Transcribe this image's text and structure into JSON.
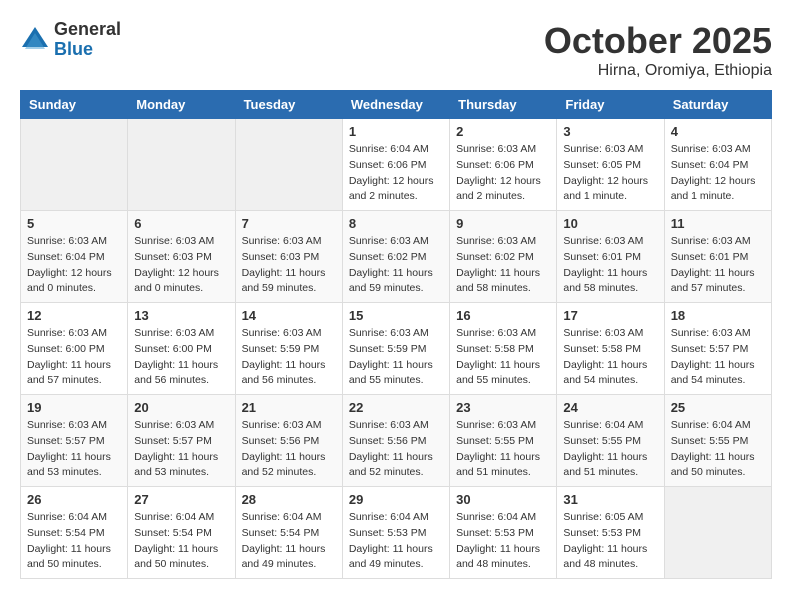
{
  "logo": {
    "general": "General",
    "blue": "Blue"
  },
  "header": {
    "month": "October 2025",
    "location": "Hirna, Oromiya, Ethiopia"
  },
  "weekdays": [
    "Sunday",
    "Monday",
    "Tuesday",
    "Wednesday",
    "Thursday",
    "Friday",
    "Saturday"
  ],
  "weeks": [
    [
      {
        "day": "",
        "info": ""
      },
      {
        "day": "",
        "info": ""
      },
      {
        "day": "",
        "info": ""
      },
      {
        "day": "1",
        "info": "Sunrise: 6:04 AM\nSunset: 6:06 PM\nDaylight: 12 hours\nand 2 minutes."
      },
      {
        "day": "2",
        "info": "Sunrise: 6:03 AM\nSunset: 6:06 PM\nDaylight: 12 hours\nand 2 minutes."
      },
      {
        "day": "3",
        "info": "Sunrise: 6:03 AM\nSunset: 6:05 PM\nDaylight: 12 hours\nand 1 minute."
      },
      {
        "day": "4",
        "info": "Sunrise: 6:03 AM\nSunset: 6:04 PM\nDaylight: 12 hours\nand 1 minute."
      }
    ],
    [
      {
        "day": "5",
        "info": "Sunrise: 6:03 AM\nSunset: 6:04 PM\nDaylight: 12 hours\nand 0 minutes."
      },
      {
        "day": "6",
        "info": "Sunrise: 6:03 AM\nSunset: 6:03 PM\nDaylight: 12 hours\nand 0 minutes."
      },
      {
        "day": "7",
        "info": "Sunrise: 6:03 AM\nSunset: 6:03 PM\nDaylight: 11 hours\nand 59 minutes."
      },
      {
        "day": "8",
        "info": "Sunrise: 6:03 AM\nSunset: 6:02 PM\nDaylight: 11 hours\nand 59 minutes."
      },
      {
        "day": "9",
        "info": "Sunrise: 6:03 AM\nSunset: 6:02 PM\nDaylight: 11 hours\nand 58 minutes."
      },
      {
        "day": "10",
        "info": "Sunrise: 6:03 AM\nSunset: 6:01 PM\nDaylight: 11 hours\nand 58 minutes."
      },
      {
        "day": "11",
        "info": "Sunrise: 6:03 AM\nSunset: 6:01 PM\nDaylight: 11 hours\nand 57 minutes."
      }
    ],
    [
      {
        "day": "12",
        "info": "Sunrise: 6:03 AM\nSunset: 6:00 PM\nDaylight: 11 hours\nand 57 minutes."
      },
      {
        "day": "13",
        "info": "Sunrise: 6:03 AM\nSunset: 6:00 PM\nDaylight: 11 hours\nand 56 minutes."
      },
      {
        "day": "14",
        "info": "Sunrise: 6:03 AM\nSunset: 5:59 PM\nDaylight: 11 hours\nand 56 minutes."
      },
      {
        "day": "15",
        "info": "Sunrise: 6:03 AM\nSunset: 5:59 PM\nDaylight: 11 hours\nand 55 minutes."
      },
      {
        "day": "16",
        "info": "Sunrise: 6:03 AM\nSunset: 5:58 PM\nDaylight: 11 hours\nand 55 minutes."
      },
      {
        "day": "17",
        "info": "Sunrise: 6:03 AM\nSunset: 5:58 PM\nDaylight: 11 hours\nand 54 minutes."
      },
      {
        "day": "18",
        "info": "Sunrise: 6:03 AM\nSunset: 5:57 PM\nDaylight: 11 hours\nand 54 minutes."
      }
    ],
    [
      {
        "day": "19",
        "info": "Sunrise: 6:03 AM\nSunset: 5:57 PM\nDaylight: 11 hours\nand 53 minutes."
      },
      {
        "day": "20",
        "info": "Sunrise: 6:03 AM\nSunset: 5:57 PM\nDaylight: 11 hours\nand 53 minutes."
      },
      {
        "day": "21",
        "info": "Sunrise: 6:03 AM\nSunset: 5:56 PM\nDaylight: 11 hours\nand 52 minutes."
      },
      {
        "day": "22",
        "info": "Sunrise: 6:03 AM\nSunset: 5:56 PM\nDaylight: 11 hours\nand 52 minutes."
      },
      {
        "day": "23",
        "info": "Sunrise: 6:03 AM\nSunset: 5:55 PM\nDaylight: 11 hours\nand 51 minutes."
      },
      {
        "day": "24",
        "info": "Sunrise: 6:04 AM\nSunset: 5:55 PM\nDaylight: 11 hours\nand 51 minutes."
      },
      {
        "day": "25",
        "info": "Sunrise: 6:04 AM\nSunset: 5:55 PM\nDaylight: 11 hours\nand 50 minutes."
      }
    ],
    [
      {
        "day": "26",
        "info": "Sunrise: 6:04 AM\nSunset: 5:54 PM\nDaylight: 11 hours\nand 50 minutes."
      },
      {
        "day": "27",
        "info": "Sunrise: 6:04 AM\nSunset: 5:54 PM\nDaylight: 11 hours\nand 50 minutes."
      },
      {
        "day": "28",
        "info": "Sunrise: 6:04 AM\nSunset: 5:54 PM\nDaylight: 11 hours\nand 49 minutes."
      },
      {
        "day": "29",
        "info": "Sunrise: 6:04 AM\nSunset: 5:53 PM\nDaylight: 11 hours\nand 49 minutes."
      },
      {
        "day": "30",
        "info": "Sunrise: 6:04 AM\nSunset: 5:53 PM\nDaylight: 11 hours\nand 48 minutes."
      },
      {
        "day": "31",
        "info": "Sunrise: 6:05 AM\nSunset: 5:53 PM\nDaylight: 11 hours\nand 48 minutes."
      },
      {
        "day": "",
        "info": ""
      }
    ]
  ]
}
